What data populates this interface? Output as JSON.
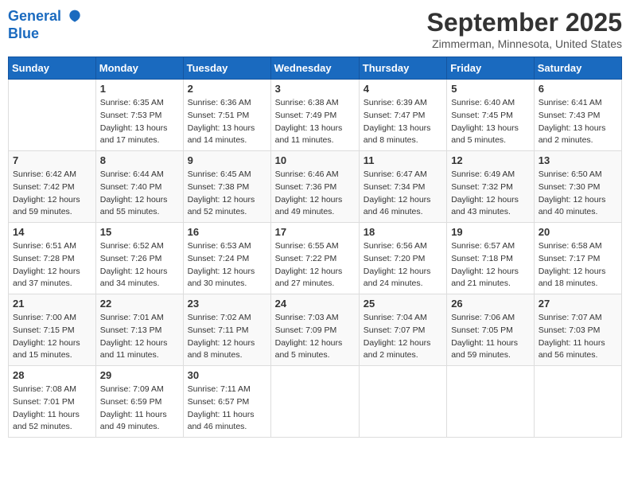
{
  "header": {
    "logo_line1": "General",
    "logo_line2": "Blue",
    "title": "September 2025",
    "location": "Zimmerman, Minnesota, United States"
  },
  "weekdays": [
    "Sunday",
    "Monday",
    "Tuesday",
    "Wednesday",
    "Thursday",
    "Friday",
    "Saturday"
  ],
  "weeks": [
    [
      {
        "day": "",
        "info": ""
      },
      {
        "day": "1",
        "info": "Sunrise: 6:35 AM\nSunset: 7:53 PM\nDaylight: 13 hours\nand 17 minutes."
      },
      {
        "day": "2",
        "info": "Sunrise: 6:36 AM\nSunset: 7:51 PM\nDaylight: 13 hours\nand 14 minutes."
      },
      {
        "day": "3",
        "info": "Sunrise: 6:38 AM\nSunset: 7:49 PM\nDaylight: 13 hours\nand 11 minutes."
      },
      {
        "day": "4",
        "info": "Sunrise: 6:39 AM\nSunset: 7:47 PM\nDaylight: 13 hours\nand 8 minutes."
      },
      {
        "day": "5",
        "info": "Sunrise: 6:40 AM\nSunset: 7:45 PM\nDaylight: 13 hours\nand 5 minutes."
      },
      {
        "day": "6",
        "info": "Sunrise: 6:41 AM\nSunset: 7:43 PM\nDaylight: 13 hours\nand 2 minutes."
      }
    ],
    [
      {
        "day": "7",
        "info": "Sunrise: 6:42 AM\nSunset: 7:42 PM\nDaylight: 12 hours\nand 59 minutes."
      },
      {
        "day": "8",
        "info": "Sunrise: 6:44 AM\nSunset: 7:40 PM\nDaylight: 12 hours\nand 55 minutes."
      },
      {
        "day": "9",
        "info": "Sunrise: 6:45 AM\nSunset: 7:38 PM\nDaylight: 12 hours\nand 52 minutes."
      },
      {
        "day": "10",
        "info": "Sunrise: 6:46 AM\nSunset: 7:36 PM\nDaylight: 12 hours\nand 49 minutes."
      },
      {
        "day": "11",
        "info": "Sunrise: 6:47 AM\nSunset: 7:34 PM\nDaylight: 12 hours\nand 46 minutes."
      },
      {
        "day": "12",
        "info": "Sunrise: 6:49 AM\nSunset: 7:32 PM\nDaylight: 12 hours\nand 43 minutes."
      },
      {
        "day": "13",
        "info": "Sunrise: 6:50 AM\nSunset: 7:30 PM\nDaylight: 12 hours\nand 40 minutes."
      }
    ],
    [
      {
        "day": "14",
        "info": "Sunrise: 6:51 AM\nSunset: 7:28 PM\nDaylight: 12 hours\nand 37 minutes."
      },
      {
        "day": "15",
        "info": "Sunrise: 6:52 AM\nSunset: 7:26 PM\nDaylight: 12 hours\nand 34 minutes."
      },
      {
        "day": "16",
        "info": "Sunrise: 6:53 AM\nSunset: 7:24 PM\nDaylight: 12 hours\nand 30 minutes."
      },
      {
        "day": "17",
        "info": "Sunrise: 6:55 AM\nSunset: 7:22 PM\nDaylight: 12 hours\nand 27 minutes."
      },
      {
        "day": "18",
        "info": "Sunrise: 6:56 AM\nSunset: 7:20 PM\nDaylight: 12 hours\nand 24 minutes."
      },
      {
        "day": "19",
        "info": "Sunrise: 6:57 AM\nSunset: 7:18 PM\nDaylight: 12 hours\nand 21 minutes."
      },
      {
        "day": "20",
        "info": "Sunrise: 6:58 AM\nSunset: 7:17 PM\nDaylight: 12 hours\nand 18 minutes."
      }
    ],
    [
      {
        "day": "21",
        "info": "Sunrise: 7:00 AM\nSunset: 7:15 PM\nDaylight: 12 hours\nand 15 minutes."
      },
      {
        "day": "22",
        "info": "Sunrise: 7:01 AM\nSunset: 7:13 PM\nDaylight: 12 hours\nand 11 minutes."
      },
      {
        "day": "23",
        "info": "Sunrise: 7:02 AM\nSunset: 7:11 PM\nDaylight: 12 hours\nand 8 minutes."
      },
      {
        "day": "24",
        "info": "Sunrise: 7:03 AM\nSunset: 7:09 PM\nDaylight: 12 hours\nand 5 minutes."
      },
      {
        "day": "25",
        "info": "Sunrise: 7:04 AM\nSunset: 7:07 PM\nDaylight: 12 hours\nand 2 minutes."
      },
      {
        "day": "26",
        "info": "Sunrise: 7:06 AM\nSunset: 7:05 PM\nDaylight: 11 hours\nand 59 minutes."
      },
      {
        "day": "27",
        "info": "Sunrise: 7:07 AM\nSunset: 7:03 PM\nDaylight: 11 hours\nand 56 minutes."
      }
    ],
    [
      {
        "day": "28",
        "info": "Sunrise: 7:08 AM\nSunset: 7:01 PM\nDaylight: 11 hours\nand 52 minutes."
      },
      {
        "day": "29",
        "info": "Sunrise: 7:09 AM\nSunset: 6:59 PM\nDaylight: 11 hours\nand 49 minutes."
      },
      {
        "day": "30",
        "info": "Sunrise: 7:11 AM\nSunset: 6:57 PM\nDaylight: 11 hours\nand 46 minutes."
      },
      {
        "day": "",
        "info": ""
      },
      {
        "day": "",
        "info": ""
      },
      {
        "day": "",
        "info": ""
      },
      {
        "day": "",
        "info": ""
      }
    ]
  ]
}
